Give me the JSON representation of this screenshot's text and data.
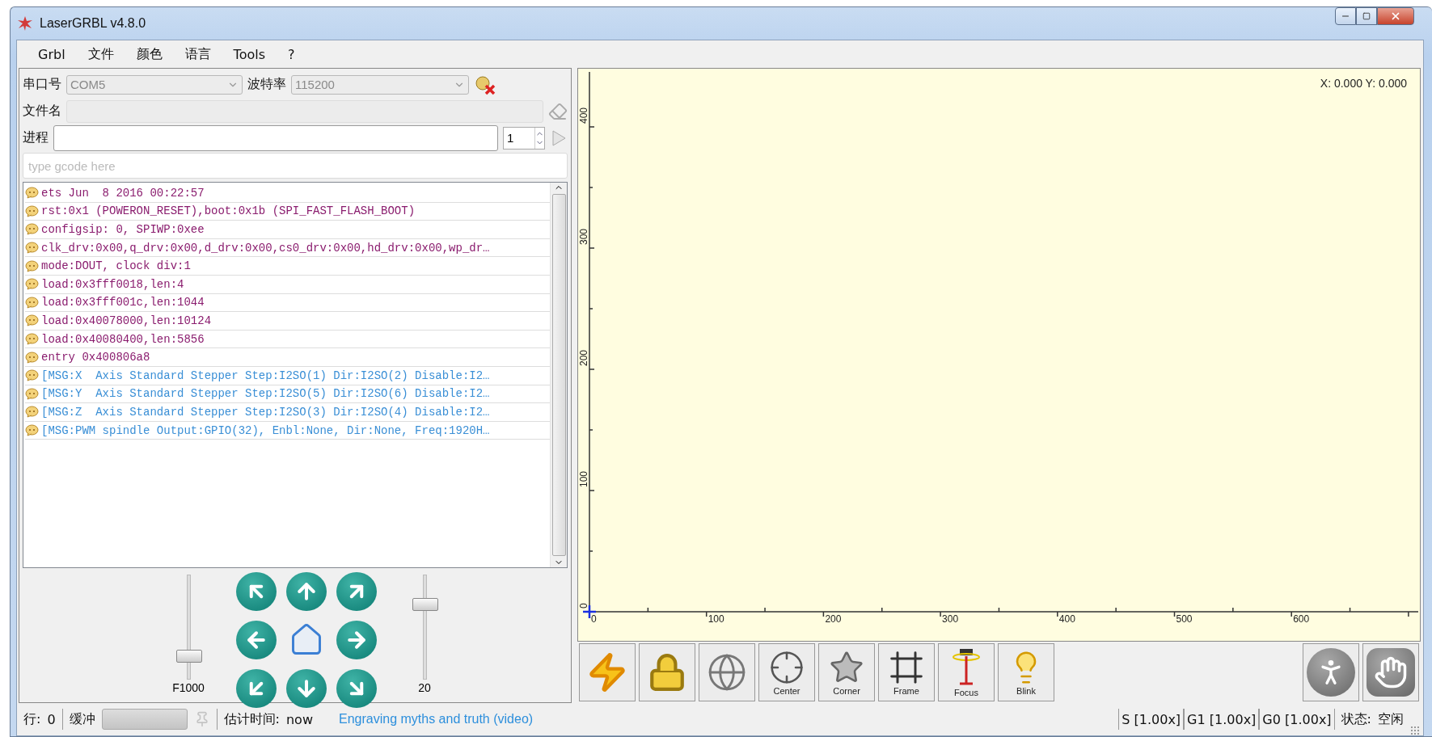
{
  "window": {
    "title": "LaserGRBL v4.8.0"
  },
  "menu": [
    "Grbl",
    "文件",
    "颜色",
    "语言",
    "Tools",
    "?"
  ],
  "connection": {
    "port_label": "串口号",
    "port": "COM5",
    "baud_label": "波特率",
    "baud": "115200"
  },
  "file": {
    "label": "文件名"
  },
  "progress": {
    "label": "进程",
    "passes": "1",
    "level": 0
  },
  "gcode": {
    "placeholder": "type gcode here"
  },
  "log": [
    {
      "kind": "boot",
      "text": "ets Jun  8 2016 00:22:57"
    },
    {
      "kind": "boot",
      "text": "rst:0x1 (POWERON_RESET),boot:0x1b (SPI_FAST_FLASH_BOOT)"
    },
    {
      "kind": "boot",
      "text": "configsip: 0, SPIWP:0xee"
    },
    {
      "kind": "boot",
      "text": "clk_drv:0x00,q_drv:0x00,d_drv:0x00,cs0_drv:0x00,hd_drv:0x00,wp_dr…"
    },
    {
      "kind": "boot",
      "text": "mode:DOUT, clock div:1"
    },
    {
      "kind": "boot",
      "text": "load:0x3fff0018,len:4"
    },
    {
      "kind": "boot",
      "text": "load:0x3fff001c,len:1044"
    },
    {
      "kind": "boot",
      "text": "load:0x40078000,len:10124"
    },
    {
      "kind": "boot",
      "text": "load:0x40080400,len:5856"
    },
    {
      "kind": "boot",
      "text": "entry 0x400806a8"
    },
    {
      "kind": "msg",
      "text": "[MSG:X  Axis Standard Stepper Step:I2SO(1) Dir:I2SO(2) Disable:I2…"
    },
    {
      "kind": "msg",
      "text": "[MSG:Y  Axis Standard Stepper Step:I2SO(5) Dir:I2SO(6) Disable:I2…"
    },
    {
      "kind": "msg",
      "text": "[MSG:Z  Axis Standard Stepper Step:I2SO(3) Dir:I2SO(4) Disable:I2…"
    },
    {
      "kind": "msg",
      "text": "[MSG:PWM spindle Output:GPIO(32), Enbl:None, Dir:None, Freq:1920H…"
    }
  ],
  "jog": {
    "feed_slider": {
      "reading": "F1000",
      "level": 0.2
    },
    "step_slider": {
      "reading": "20",
      "level": 0.75
    },
    "buttons": [
      {
        "kind": "nw"
      },
      {
        "kind": "n"
      },
      {
        "kind": "ne"
      },
      {
        "kind": "w"
      },
      {
        "kind": "home"
      },
      {
        "kind": "e"
      },
      {
        "kind": "sw"
      },
      {
        "kind": "s"
      },
      {
        "kind": "se"
      }
    ]
  },
  "canvas": {
    "position": "X: 0.000 Y: 0.000",
    "x_labels": [
      "0",
      "100",
      "200",
      "300",
      "400",
      "500",
      "600"
    ],
    "y_labels": [
      "0",
      "100",
      "200",
      "300",
      "400"
    ]
  },
  "toolbar": {
    "tools": [
      {
        "kind": "connect"
      },
      {
        "kind": "unlock"
      },
      {
        "kind": "origin"
      },
      {
        "kind": "center",
        "label": "Center"
      },
      {
        "kind": "corner",
        "label": "Corner"
      },
      {
        "kind": "frame",
        "label": "Frame"
      },
      {
        "kind": "focus",
        "label": "Focus"
      },
      {
        "kind": "blink",
        "label": "Blink"
      }
    ],
    "actions": [
      {
        "kind": "resume"
      },
      {
        "kind": "stop"
      }
    ]
  },
  "status_bar": {
    "line_label": "行:",
    "line": "0",
    "buffer_label": "缓冲",
    "time_label": "估计时间:",
    "time": "now",
    "link": "Engraving myths and truth (video)",
    "overrides": [
      "S [1.00x]",
      "G1 [1.00x]",
      "G0 [1.00x]"
    ],
    "state_label": "状态:",
    "state": "空闲"
  }
}
